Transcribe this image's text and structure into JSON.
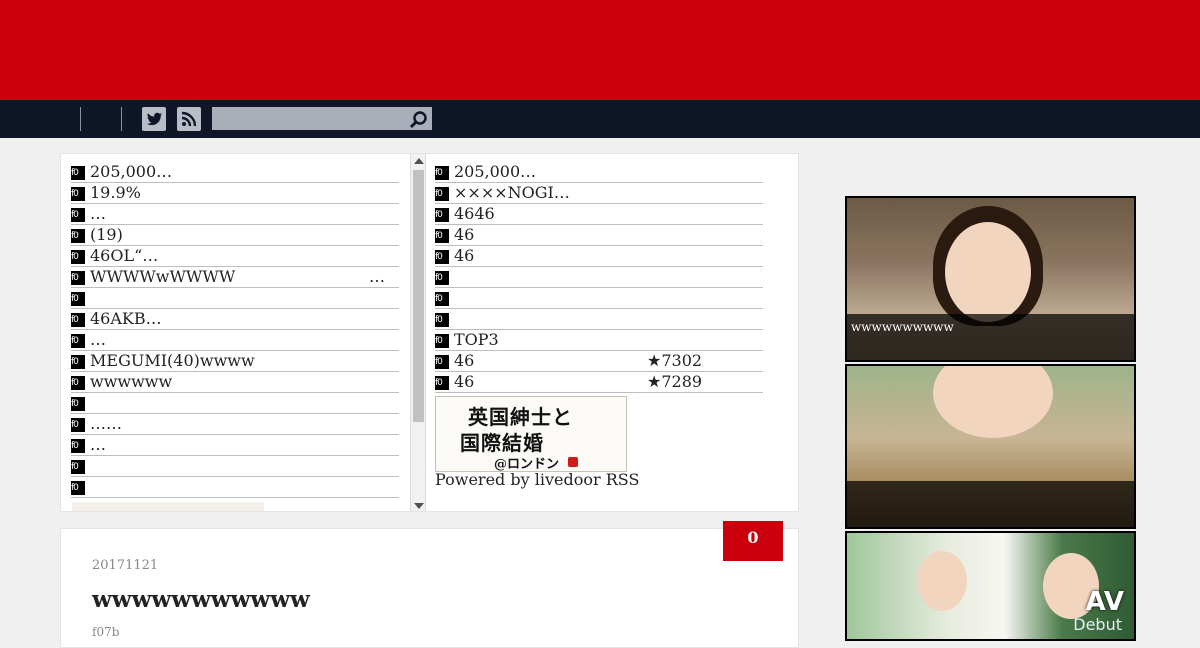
{
  "colors": {
    "header_bg": "#cc000c",
    "nav_bg": "#0f1628",
    "count_badge_bg": "#cc000c"
  },
  "nav": {
    "social": [
      {
        "icon": "twitter-icon"
      },
      {
        "icon": "rss-icon"
      }
    ],
    "search": {
      "placeholder": "",
      "value": "",
      "icon": "search-icon"
    }
  },
  "rss": {
    "item_icon_text": "f0",
    "left": [
      {
        "title": "205,000…",
        "meta": ""
      },
      {
        "title": "19.9%",
        "meta": ""
      },
      {
        "title": "…",
        "meta": ""
      },
      {
        "title": "(19)",
        "meta": ""
      },
      {
        "title": "46OL“…",
        "meta": ""
      },
      {
        "title": "WWWWwWWWW",
        "meta": "…"
      },
      {
        "title": "",
        "meta": ""
      },
      {
        "title": "46AKB…",
        "meta": ""
      },
      {
        "title": "…",
        "meta": ""
      },
      {
        "title": "MEGUMI(40)wwww",
        "meta": ""
      },
      {
        "title": "wwwwww",
        "meta": ""
      },
      {
        "title": "",
        "meta": ""
      },
      {
        "title": "……",
        "meta": ""
      },
      {
        "title": "…",
        "meta": ""
      },
      {
        "title": "",
        "meta": ""
      },
      {
        "title": "",
        "meta": ""
      }
    ],
    "right": [
      {
        "title": "205,000…",
        "meta": ""
      },
      {
        "title": "××××NOGI…",
        "meta": ""
      },
      {
        "title": "4646",
        "meta": ""
      },
      {
        "title": "46",
        "meta": ""
      },
      {
        "title": "46",
        "meta": ""
      },
      {
        "title": "",
        "meta": ""
      },
      {
        "title": "",
        "meta": ""
      },
      {
        "title": "",
        "meta": ""
      },
      {
        "title": "TOP3",
        "meta": ""
      },
      {
        "title": "46",
        "meta": "★7302"
      },
      {
        "title": "46",
        "meta": "★7289"
      }
    ],
    "banner": {
      "line1": "英国紳士と",
      "line2": "国際結婚",
      "line3": "@ロンドン"
    },
    "powered_by": "Powered by livedoor RSS"
  },
  "post": {
    "comment_count": "0",
    "date": "20171121",
    "title": "wwwwwwwwwww",
    "category": "f07b"
  },
  "sidebar": {
    "cards": [
      {
        "caption": "wwwwwwwwww"
      },
      {
        "caption": ""
      },
      {
        "caption": "",
        "badge": "AV",
        "badge_sub": "Debut"
      }
    ]
  }
}
